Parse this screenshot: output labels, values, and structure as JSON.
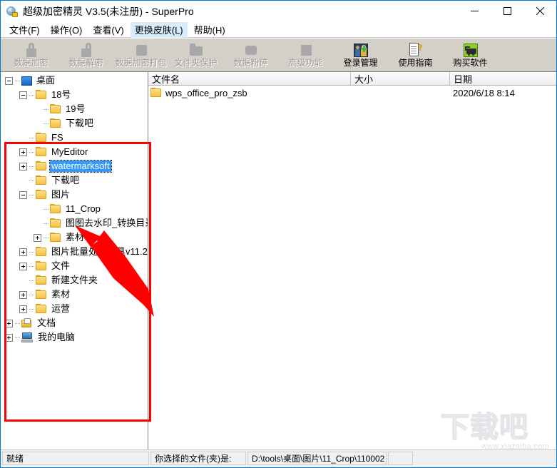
{
  "window": {
    "title": "超级加密精灵 V3.5(未注册) - SuperPro",
    "app_icon": "lock-disc-icon",
    "minimize_label": "−",
    "maximize_label": "□",
    "close_label": "✕"
  },
  "menubar": {
    "items": [
      {
        "label": "文件(F)",
        "active": false
      },
      {
        "label": "操作(O)",
        "active": false
      },
      {
        "label": "查看(V)",
        "active": false
      },
      {
        "label": "更换皮肤(L)",
        "active": true
      },
      {
        "label": "帮助(H)",
        "active": false
      }
    ]
  },
  "toolbar": {
    "buttons": [
      {
        "label": "数据加密",
        "icon": "lock-icon",
        "enabled": false
      },
      {
        "label": "数据解密",
        "icon": "unlock-icon",
        "enabled": false
      },
      {
        "label": "数据加密打包",
        "icon": "package-icon",
        "enabled": false
      },
      {
        "label": "文件夹保护",
        "icon": "folder-shield-icon",
        "enabled": false
      },
      {
        "label": "数据粉碎",
        "icon": "shredder-icon",
        "enabled": false
      },
      {
        "label": "高级功能",
        "icon": "advanced-icon",
        "enabled": false
      },
      {
        "label": "登录管理",
        "icon": "users-icon",
        "enabled": true
      },
      {
        "label": "使用指南",
        "icon": "guide-icon",
        "enabled": true
      },
      {
        "label": "购买软件",
        "icon": "cart-icon",
        "enabled": true
      }
    ]
  },
  "tree": {
    "nodes": [
      {
        "label": "桌面",
        "depth": 0,
        "icon": "desktop-icon",
        "expander": "minus",
        "selected": false
      },
      {
        "label": "18号",
        "depth": 1,
        "icon": "folder-icon",
        "expander": "minus",
        "selected": false
      },
      {
        "label": "19号",
        "depth": 2,
        "icon": "folder-icon",
        "expander": "none",
        "selected": false
      },
      {
        "label": "下载吧",
        "depth": 2,
        "icon": "folder-icon",
        "expander": "none",
        "selected": false
      },
      {
        "label": "FS",
        "depth": 1,
        "icon": "folder-icon",
        "expander": "none",
        "selected": false
      },
      {
        "label": "MyEditor",
        "depth": 1,
        "icon": "folder-icon",
        "expander": "plus",
        "selected": false
      },
      {
        "label": "watermarksoft",
        "depth": 1,
        "icon": "folder-icon",
        "expander": "plus",
        "selected": true
      },
      {
        "label": "下载吧",
        "depth": 1,
        "icon": "folder-icon",
        "expander": "none",
        "selected": false
      },
      {
        "label": "图片",
        "depth": 1,
        "icon": "folder-icon",
        "expander": "minus",
        "selected": false
      },
      {
        "label": "11_Crop",
        "depth": 2,
        "icon": "folder-icon",
        "expander": "none",
        "selected": false
      },
      {
        "label": "图图去水印_转换目录",
        "depth": 2,
        "icon": "folder-icon",
        "expander": "none",
        "selected": false
      },
      {
        "label": "素材",
        "depth": 2,
        "icon": "folder-icon",
        "expander": "plus",
        "selected": false
      },
      {
        "label": "图片批量处理工具v11.2",
        "depth": 1,
        "icon": "folder-icon",
        "expander": "plus",
        "selected": false
      },
      {
        "label": "文件",
        "depth": 1,
        "icon": "folder-icon",
        "expander": "plus",
        "selected": false
      },
      {
        "label": "新建文件夹",
        "depth": 1,
        "icon": "folder-icon",
        "expander": "none",
        "selected": false
      },
      {
        "label": "素材",
        "depth": 1,
        "icon": "folder-icon",
        "expander": "plus",
        "selected": false
      },
      {
        "label": "运营",
        "depth": 1,
        "icon": "folder-icon",
        "expander": "plus",
        "selected": false
      },
      {
        "label": "文档",
        "depth": 0,
        "icon": "documents-icon",
        "expander": "plus",
        "selected": false
      },
      {
        "label": "我的电脑",
        "depth": 0,
        "icon": "computer-icon",
        "expander": "plus",
        "selected": false
      }
    ]
  },
  "filelist": {
    "columns": [
      {
        "label": "文件名"
      },
      {
        "label": "大小"
      },
      {
        "label": "日期"
      }
    ],
    "rows": [
      {
        "name": "wps_office_pro_zsb",
        "size": "",
        "date": "2020/6/18 8:14",
        "icon": "folder-icon"
      }
    ]
  },
  "statusbar": {
    "ready": "就绪",
    "selection_label": "你选择的文件(夹)是:",
    "selection_path": "D:\\tools\\桌面\\图片\\11_Crop\\110002",
    "extra": ""
  },
  "annotations": {
    "highlight_color": "#ff0000",
    "box": "tree-panel-highlight",
    "arrow": "points-to-tree-folder"
  },
  "watermark": {
    "text": "下载吧",
    "url": "www.xiazaiba.com"
  }
}
